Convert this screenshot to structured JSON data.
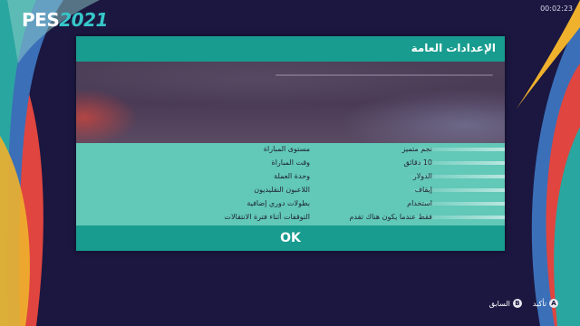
{
  "app": {
    "logo_prefix": "PES",
    "logo_year": "2021",
    "clock": "00:02:23"
  },
  "dialog": {
    "title": "الإعدادات العامة",
    "settings": [
      {
        "label": "مستوى المباراة",
        "value": "نجم متميز"
      },
      {
        "label": "وقت المباراة",
        "value": "10 دقائق"
      },
      {
        "label": "وحدة العملة",
        "value": "الدولار"
      },
      {
        "label": "اللاعبون النقليديون",
        "value": "إيقاف"
      },
      {
        "label": "بطولات دوري إضافية",
        "value": "استخدام"
      },
      {
        "label": "التوقفات أثناء فترة الانتقالات",
        "value": "فقط عندما يكون هناك تقدم"
      }
    ],
    "ok_label": "OK"
  },
  "footer": {
    "confirm_button": "A",
    "confirm_label": "تأكيد",
    "back_button": "B",
    "back_label": "السابق"
  },
  "colors": {
    "background": "#1b1740",
    "teal_bar": "#189c8f",
    "settings_bg": "#62c8b8",
    "accent_logo": "#37c6c9"
  },
  "icons": [
    "a-button-icon",
    "b-button-icon"
  ]
}
